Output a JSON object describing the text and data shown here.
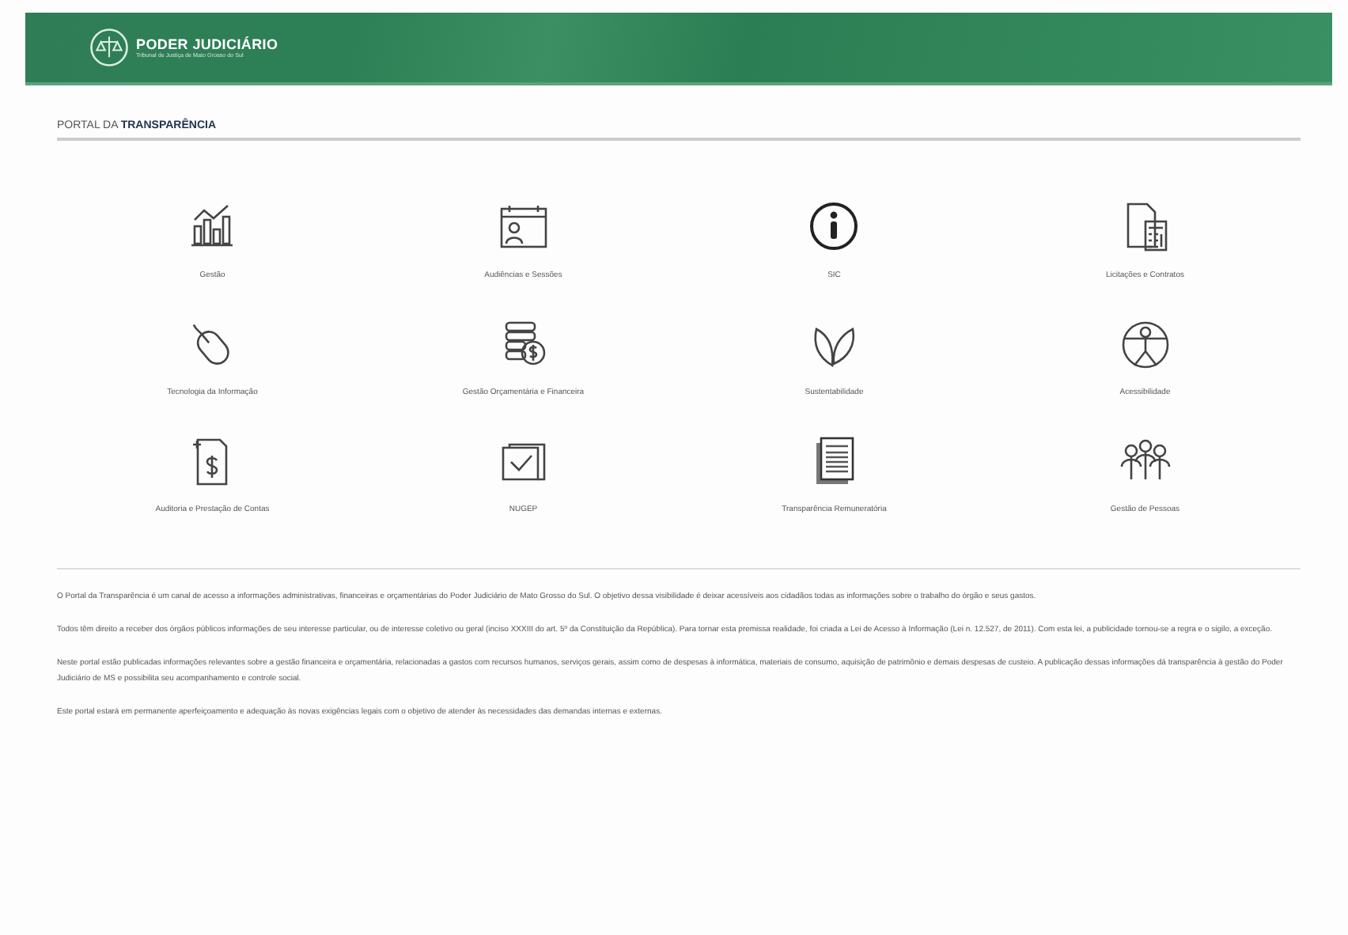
{
  "header": {
    "logo_title": "PODER JUDICIÁRIO",
    "logo_subtitle": "Tribunal de Justiça de Mato Grosso do Sul"
  },
  "page_title": {
    "prefix": "PORTAL DA",
    "emphasis": "TRANSPARÊNCIA"
  },
  "tiles": [
    {
      "label": "Gestão",
      "kind": "chart"
    },
    {
      "label": "Audiências e Sessões",
      "kind": "calendar"
    },
    {
      "label": "SIC",
      "kind": "info"
    },
    {
      "label": "Licitações e Contratos",
      "kind": "calculator"
    },
    {
      "label": "Tecnologia da Informação",
      "kind": "mouse"
    },
    {
      "label": "Gestão Orçamentária e Financeira",
      "kind": "coins"
    },
    {
      "label": "Sustentabilidade",
      "kind": "leaves"
    },
    {
      "label": "Acessibilidade",
      "kind": "accessibility"
    },
    {
      "label": "Auditoria e Prestação de Contas",
      "kind": "invoice"
    },
    {
      "label": "NUGEP",
      "kind": "folder"
    },
    {
      "label": "Transparência Remuneratória",
      "kind": "document"
    },
    {
      "label": "Gestão de Pessoas",
      "kind": "people"
    }
  ],
  "paragraphs": [
    "O Portal da Transparência é um canal de acesso a informações administrativas, financeiras e orçamentárias do Poder Judiciário de Mato Grosso do Sul. O objetivo dessa visibilidade é deixar acessíveis aos cidadãos todas as informações sobre o trabalho do órgão e seus gastos.",
    "Todos têm direito a receber dos órgãos públicos informações de seu interesse particular, ou de interesse coletivo ou geral (inciso XXXIII do art. 5º da Constituição da República). Para tornar esta premissa realidade, foi criada a Lei de Acesso à Informação (Lei n. 12.527, de 2011). Com esta lei, a publicidade tornou-se a regra e o sigilo, a exceção.",
    "Neste portal estão publicadas informações relevantes sobre a gestão financeira e orçamentária, relacionadas a gastos com recursos humanos, serviços gerais, assim como de despesas à informática, materiais de consumo, aquisição de patrimônio e demais despesas de custeio. A publicação dessas informações dá transparência à gestão do Poder Judiciário de MS e possibilita seu acompanhamento e controle social.",
    "Este portal estará em permanente aperfeiçoamento e adequação às novas exigências legais com o objetivo de atender às necessidades das demandas internas e externas."
  ]
}
